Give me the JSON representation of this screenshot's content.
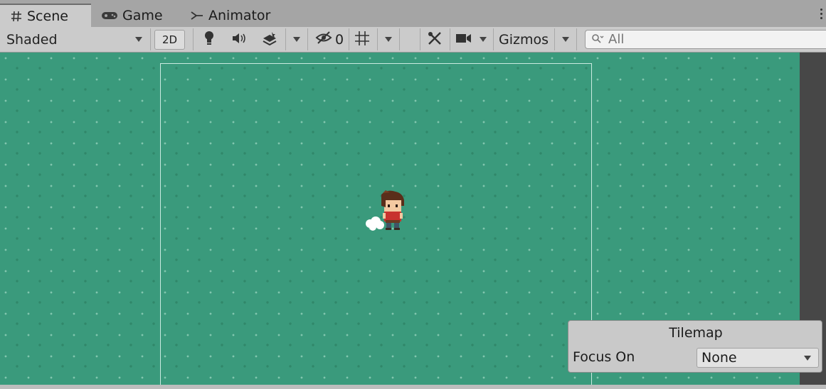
{
  "tabs": [
    {
      "label": "Scene",
      "icon": "hash-icon",
      "active": true
    },
    {
      "label": "Game",
      "icon": "gamepad-icon",
      "active": false
    },
    {
      "label": "Animator",
      "icon": "animator-icon",
      "active": false
    }
  ],
  "toolbar": {
    "draw_mode": "Shaded",
    "mode_2d_label": "2D",
    "hidden_count": "0",
    "gizmos_label": "Gizmos",
    "search_placeholder": "All"
  },
  "tilemap_panel": {
    "title": "Tilemap",
    "focus_label": "Focus On",
    "focus_value": "None"
  },
  "colors": {
    "scene_green": "#3a9a7c",
    "toolbar_bg": "#cbcbcb",
    "tabbar_bg": "#a5a5a5"
  }
}
